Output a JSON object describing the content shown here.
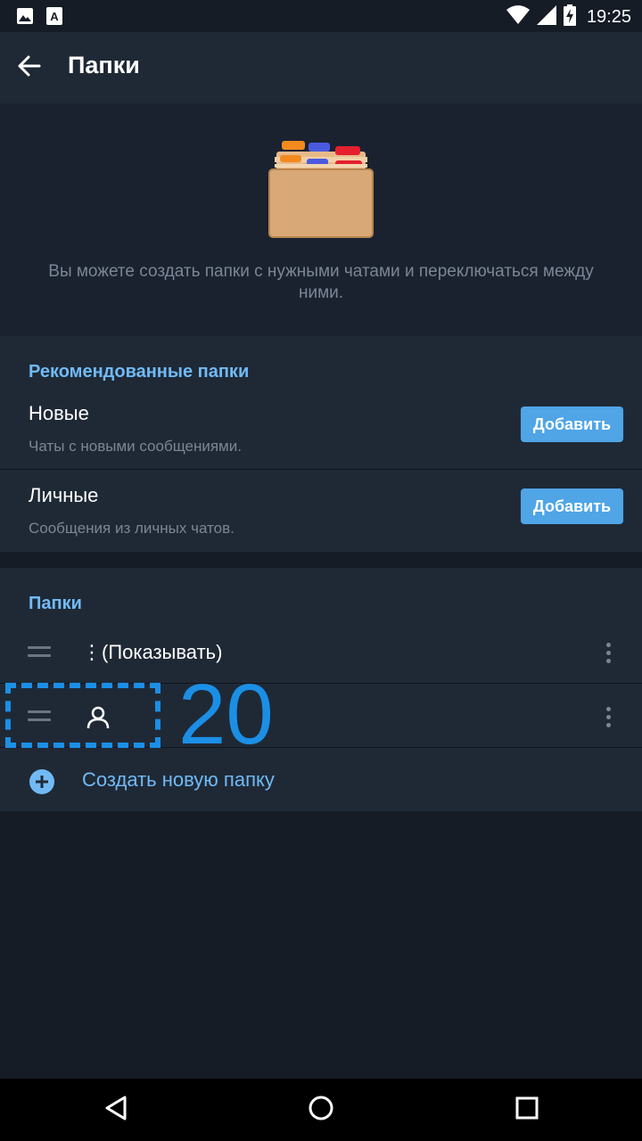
{
  "status_bar": {
    "time": "19:25",
    "icons": [
      "image-icon",
      "a-icon",
      "wifi-icon",
      "signal-icon",
      "battery-charging-icon"
    ]
  },
  "app_bar": {
    "title": "Папки",
    "back_icon": "arrow-left-icon"
  },
  "hero": {
    "icon": "file-folder-emoji",
    "text": "Вы можете создать папки с нужными чатами и переключаться между ними."
  },
  "recommended": {
    "header": "Рекомендованные папки",
    "items": [
      {
        "title": "Новые",
        "subtitle": "Чаты с новыми сообщениями.",
        "button": "Добавить"
      },
      {
        "title": "Личные",
        "subtitle": "Сообщения из личных чатов.",
        "button": "Добавить"
      }
    ]
  },
  "folders": {
    "header": "Папки",
    "items": [
      {
        "name": "⋮(Показывать)"
      },
      {
        "name": "",
        "icon": "person-icon"
      }
    ],
    "create_label": "Создать новую папку"
  },
  "annotation": {
    "number": "20",
    "color": "#1b8fe6"
  },
  "colors": {
    "accent": "#71baf5",
    "button": "#4fa5e6",
    "background": "#151c26",
    "surface": "#1f2936"
  }
}
